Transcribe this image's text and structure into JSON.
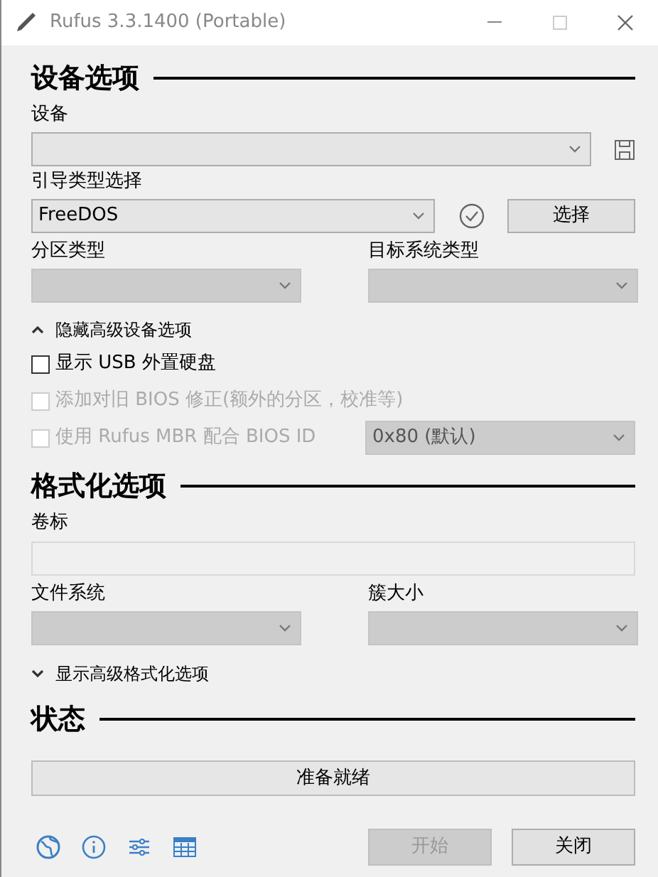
{
  "window": {
    "title": "Rufus 3.3.1400 (Portable)"
  },
  "device_options": {
    "heading": "设备选项",
    "device_label": "设备",
    "boot_label": "引导类型选择",
    "boot_value": "FreeDOS",
    "select_button": "选择",
    "partition_label": "分区类型",
    "target_label": "目标系统类型",
    "toggle": {
      "label": "隐藏高级设备选项",
      "expanded": true
    },
    "checkboxes": [
      {
        "label": "显示 USB 外置硬盘",
        "checked": false,
        "disabled": false
      },
      {
        "label": "添加对旧 BIOS 修正(额外的分区，校准等)",
        "checked": false,
        "disabled": true
      },
      {
        "label": "使用 Rufus MBR 配合 BIOS ID",
        "checked": false,
        "disabled": true
      }
    ],
    "bios_id_value": "0x80 (默认)"
  },
  "format_options": {
    "heading": "格式化选项",
    "volume_label": "卷标",
    "filesystem_label": "文件系统",
    "cluster_label": "簇大小",
    "toggle": {
      "label": "显示高级格式化选项",
      "expanded": false
    }
  },
  "status": {
    "heading": "状态",
    "text": "准备就绪"
  },
  "buttons": [
    {
      "label": "开始",
      "disabled": true
    },
    {
      "label": "关闭",
      "disabled": false
    }
  ]
}
